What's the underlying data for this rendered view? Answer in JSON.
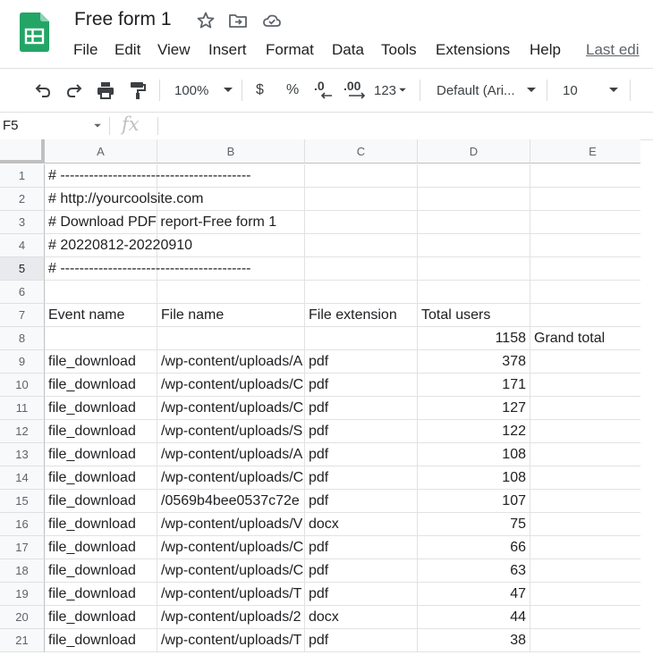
{
  "document": {
    "title": "Free form 1"
  },
  "menu": [
    "File",
    "Edit",
    "View",
    "Insert",
    "Format",
    "Data",
    "Tools",
    "Extensions",
    "Help",
    "Last edi"
  ],
  "toolbar": {
    "zoom": "100%",
    "currency": "$",
    "percent": "%",
    "decrease_decimal": ".0",
    "increase_decimal": ".00",
    "more_formats": "123",
    "font": "Default (Ari...",
    "font_size": "10"
  },
  "formula_bar": {
    "cell_ref": "F5",
    "fx": "fx",
    "value": ""
  },
  "columns": [
    "A",
    "B",
    "C",
    "D",
    "E"
  ],
  "row_numbers": [
    "1",
    "2",
    "3",
    "4",
    "5",
    "6",
    "7",
    "8",
    "9",
    "10",
    "11",
    "12",
    "13",
    "14",
    "15",
    "16",
    "17",
    "18",
    "19",
    "20",
    "21"
  ],
  "rows": [
    [
      "# ----------------------------------------",
      "",
      "",
      "",
      ""
    ],
    [
      "# http://yourcoolsite.com",
      "",
      "",
      "",
      ""
    ],
    [
      "# Download PDF report-Free form 1",
      "",
      "",
      "",
      ""
    ],
    [
      "# 20220812-20220910",
      "",
      "",
      "",
      ""
    ],
    [
      "# ----------------------------------------",
      "",
      "",
      "",
      ""
    ],
    [
      "",
      "",
      "",
      "",
      ""
    ],
    [
      "Event name",
      "File name",
      "File extension",
      "Total users",
      ""
    ],
    [
      "",
      "",
      "",
      "1158",
      "Grand total"
    ],
    [
      "file_download",
      "/wp-content/uploads/A",
      "pdf",
      "378",
      ""
    ],
    [
      "file_download",
      "/wp-content/uploads/C",
      "pdf",
      "171",
      ""
    ],
    [
      "file_download",
      "/wp-content/uploads/C",
      "pdf",
      "127",
      ""
    ],
    [
      "file_download",
      "/wp-content/uploads/S",
      "pdf",
      "122",
      ""
    ],
    [
      "file_download",
      "/wp-content/uploads/A",
      "pdf",
      "108",
      ""
    ],
    [
      "file_download",
      "/wp-content/uploads/C",
      "pdf",
      "108",
      ""
    ],
    [
      "file_download",
      "/0569b4bee0537c72e",
      "pdf",
      "107",
      ""
    ],
    [
      "file_download",
      "/wp-content/uploads/V",
      "docx",
      "75",
      ""
    ],
    [
      "file_download",
      "/wp-content/uploads/C",
      "pdf",
      "66",
      ""
    ],
    [
      "file_download",
      "/wp-content/uploads/C",
      "pdf",
      "63",
      ""
    ],
    [
      "file_download",
      "/wp-content/uploads/T",
      "pdf",
      "47",
      ""
    ],
    [
      "file_download",
      "/wp-content/uploads/2",
      "docx",
      "44",
      ""
    ],
    [
      "file_download",
      "/wp-content/uploads/T",
      "pdf",
      "38",
      ""
    ]
  ],
  "colors": {
    "sheets_green": "#23a566",
    "header_bg": "#f8f9fa",
    "grid_line": "#e2e2e2"
  }
}
